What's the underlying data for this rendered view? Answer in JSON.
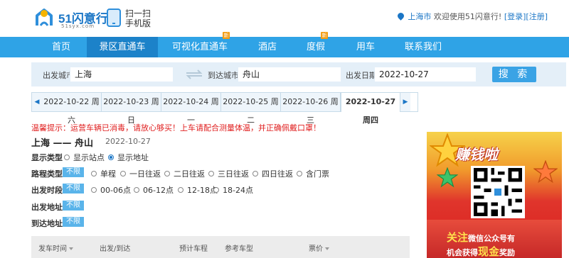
{
  "header": {
    "logo_text": "51闪意行",
    "logo_url": "51syx.com",
    "scan_line1": "扫一扫",
    "scan_line2": "手机版",
    "city": "上海市",
    "welcome": "欢迎使用51闪意行!",
    "login": "[登录]",
    "register": "[注册]"
  },
  "nav": {
    "items": [
      "首页",
      "景区直通车",
      "可视化直通车",
      "酒店",
      "度假",
      "用车",
      "联系我们"
    ],
    "active_index": 1,
    "badge": "新"
  },
  "search": {
    "from_label": "出发城市",
    "from_value": "上海",
    "to_label": "到达城市",
    "to_value": "舟山",
    "date_label": "出发日期",
    "date_value": "2022-10-27",
    "button": "搜 索"
  },
  "dates": {
    "prev": "◀",
    "next": "▶",
    "tabs": [
      "2022-10-22 周六",
      "2022-10-23 周日",
      "2022-10-24 周一",
      "2022-10-25 周二",
      "2022-10-26 周三",
      "2022-10-27 周四"
    ],
    "active_index": 5
  },
  "notice": "温馨提示：运营车辆已消毒，请放心够买！上车请配合测量体温，并正确佩戴口罩！",
  "route": {
    "title": "上海 —— 舟山",
    "date": "2022-10-27"
  },
  "filters": {
    "display_type": {
      "label": "显示类型",
      "options": [
        "显示站点",
        "显示地址"
      ],
      "selected": 1
    },
    "route_type": {
      "label": "路程类型",
      "nolimit": "不限",
      "options": [
        "单程",
        "一日往返",
        "二日往返",
        "三日往返",
        "四日往返",
        "含门票"
      ]
    },
    "time_slot": {
      "label": "出发时段",
      "nolimit": "不限",
      "options": [
        "00-06点",
        "06-12点",
        "12-18点",
        "18-24点"
      ]
    },
    "depart_addr": {
      "label": "出发地址",
      "nolimit": "不限"
    },
    "arrive_addr": {
      "label": "到达地址",
      "nolimit": "不限"
    }
  },
  "table": {
    "headers": [
      "发车时间",
      "出发/到达",
      "预计车程",
      "参考车型",
      "票价"
    ]
  },
  "ad": {
    "title": "赚钱啦",
    "line1_a": "关注",
    "line1_b": "微信公众号有",
    "line2_a": "机会获得",
    "line2_b": "现金",
    "line2_c": "奖励"
  },
  "colors": {
    "brand": "#1b76c6",
    "nav_bg": "#2fa3e6",
    "nav_active": "#1c82c9",
    "notice": "#e02020",
    "nolimit": "#5ab4ea"
  }
}
